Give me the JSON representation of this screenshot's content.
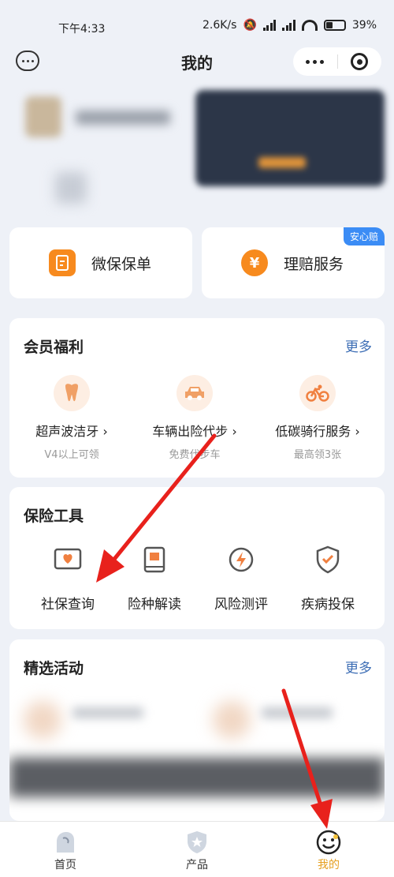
{
  "status_bar": {
    "time": "下午4:33",
    "speed": "2.6K/s",
    "battery": "39%"
  },
  "header": {
    "title": "我的"
  },
  "quick_cards": [
    {
      "label": "微保保单",
      "icon": "document-icon"
    },
    {
      "label": "理赔服务",
      "icon": "yen-icon",
      "badge": "安心赔",
      "glyph": "¥"
    }
  ],
  "benefits": {
    "title": "会员福利",
    "more": "更多",
    "items": [
      {
        "label": "超声波洁牙",
        "sub": "V4以上可领",
        "icon": "tooth-icon"
      },
      {
        "label": "车辆出险代步",
        "sub": "免费代步车",
        "icon": "car-icon"
      },
      {
        "label": "低碳骑行服务",
        "sub": "最高领3张",
        "icon": "bicycle-icon"
      }
    ]
  },
  "tools": {
    "title": "保险工具",
    "items": [
      {
        "label": "社保查询",
        "icon": "heart-card-icon"
      },
      {
        "label": "险种解读",
        "icon": "book-icon"
      },
      {
        "label": "风险测评",
        "icon": "lightning-icon"
      },
      {
        "label": "疾病投保",
        "icon": "shield-check-icon"
      }
    ]
  },
  "activities": {
    "title": "精选活动",
    "more": "更多"
  },
  "bottom_nav": [
    {
      "label": "首页",
      "icon": "home-icon"
    },
    {
      "label": "产品",
      "icon": "star-shield-icon"
    },
    {
      "label": "我的",
      "icon": "smile-icon",
      "active": true
    }
  ],
  "colors": {
    "accent": "#f78a1e",
    "link": "#3d6eb5",
    "active_nav": "#e6a020",
    "badge": "#3b8cf5",
    "arrow": "#e8211c"
  }
}
